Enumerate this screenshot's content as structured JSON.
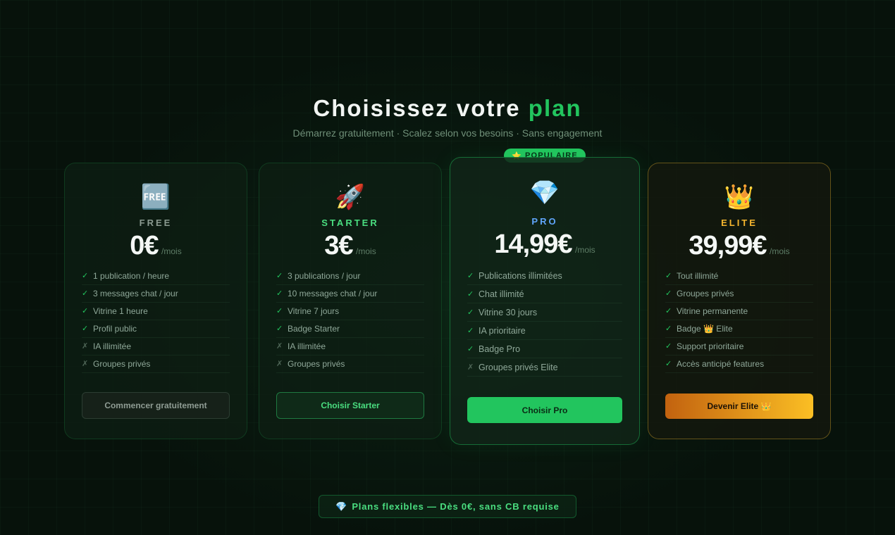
{
  "header": {
    "title_main": "Choisissez votre",
    "title_accent": "plan",
    "subtitle": "Démarrez gratuitement · Scalez selon vos besoins · Sans engagement"
  },
  "badge": {
    "icon": "⭐",
    "label": "POPULAIRE"
  },
  "plans": [
    {
      "icon": "🆓",
      "icon_name": "free-icon",
      "name": "FREE",
      "price": "0€",
      "period": "/mois",
      "features": [
        {
          "mark": "✓",
          "text": "1 publication / heure"
        },
        {
          "mark": "✓",
          "text": "3 messages chat / jour"
        },
        {
          "mark": "✓",
          "text": "Vitrine 1 heure"
        },
        {
          "mark": "✓",
          "text": "Profil public"
        },
        {
          "mark": "✗",
          "text": "IA illimitée"
        },
        {
          "mark": "✗",
          "text": "Groupes privés"
        }
      ],
      "button": "Commencer gratuitement"
    },
    {
      "icon": "🚀",
      "icon_name": "rocket-icon",
      "name": "STARTER",
      "price": "3€",
      "period": "/mois",
      "features": [
        {
          "mark": "✓",
          "text": "3 publications / jour"
        },
        {
          "mark": "✓",
          "text": "10 messages chat / jour"
        },
        {
          "mark": "✓",
          "text": "Vitrine 7 jours"
        },
        {
          "mark": "✓",
          "text": "Badge Starter"
        },
        {
          "mark": "✗",
          "text": "IA illimitée"
        },
        {
          "mark": "✗",
          "text": "Groupes privés"
        }
      ],
      "button": "Choisir Starter"
    },
    {
      "icon": "💎",
      "icon_name": "diamond-icon",
      "name": "PRO",
      "price": "14,99€",
      "period": "/mois",
      "features": [
        {
          "mark": "✓",
          "text": "Publications illimitées"
        },
        {
          "mark": "✓",
          "text": "Chat illimité"
        },
        {
          "mark": "✓",
          "text": "Vitrine 30 jours"
        },
        {
          "mark": "✓",
          "text": "IA prioritaire"
        },
        {
          "mark": "✓",
          "text": "Badge Pro"
        },
        {
          "mark": "✗",
          "text": "Groupes privés Elite"
        }
      ],
      "button": "Choisir Pro"
    },
    {
      "icon": "👑",
      "icon_name": "crown-icon",
      "name": "ELITE",
      "price": "39,99€",
      "period": "/mois",
      "features": [
        {
          "mark": "✓",
          "text": "Tout illimité"
        },
        {
          "mark": "✓",
          "text": "Groupes privés"
        },
        {
          "mark": "✓",
          "text": "Vitrine permanente"
        },
        {
          "mark": "✓",
          "text": "Badge 👑 Elite"
        },
        {
          "mark": "✓",
          "text": "Support prioritaire"
        },
        {
          "mark": "✓",
          "text": "Accès anticipé features"
        }
      ],
      "button": "Devenir Elite 👑"
    }
  ],
  "footer": {
    "icon": "💎",
    "text": "Plans flexibles — Dès 0€, sans CB requise"
  },
  "colors": {
    "accent": "#22c55e",
    "starter": "#4ade80",
    "pro": "#60a5fa",
    "elite": "#f5b52e",
    "background": "#07120b"
  }
}
